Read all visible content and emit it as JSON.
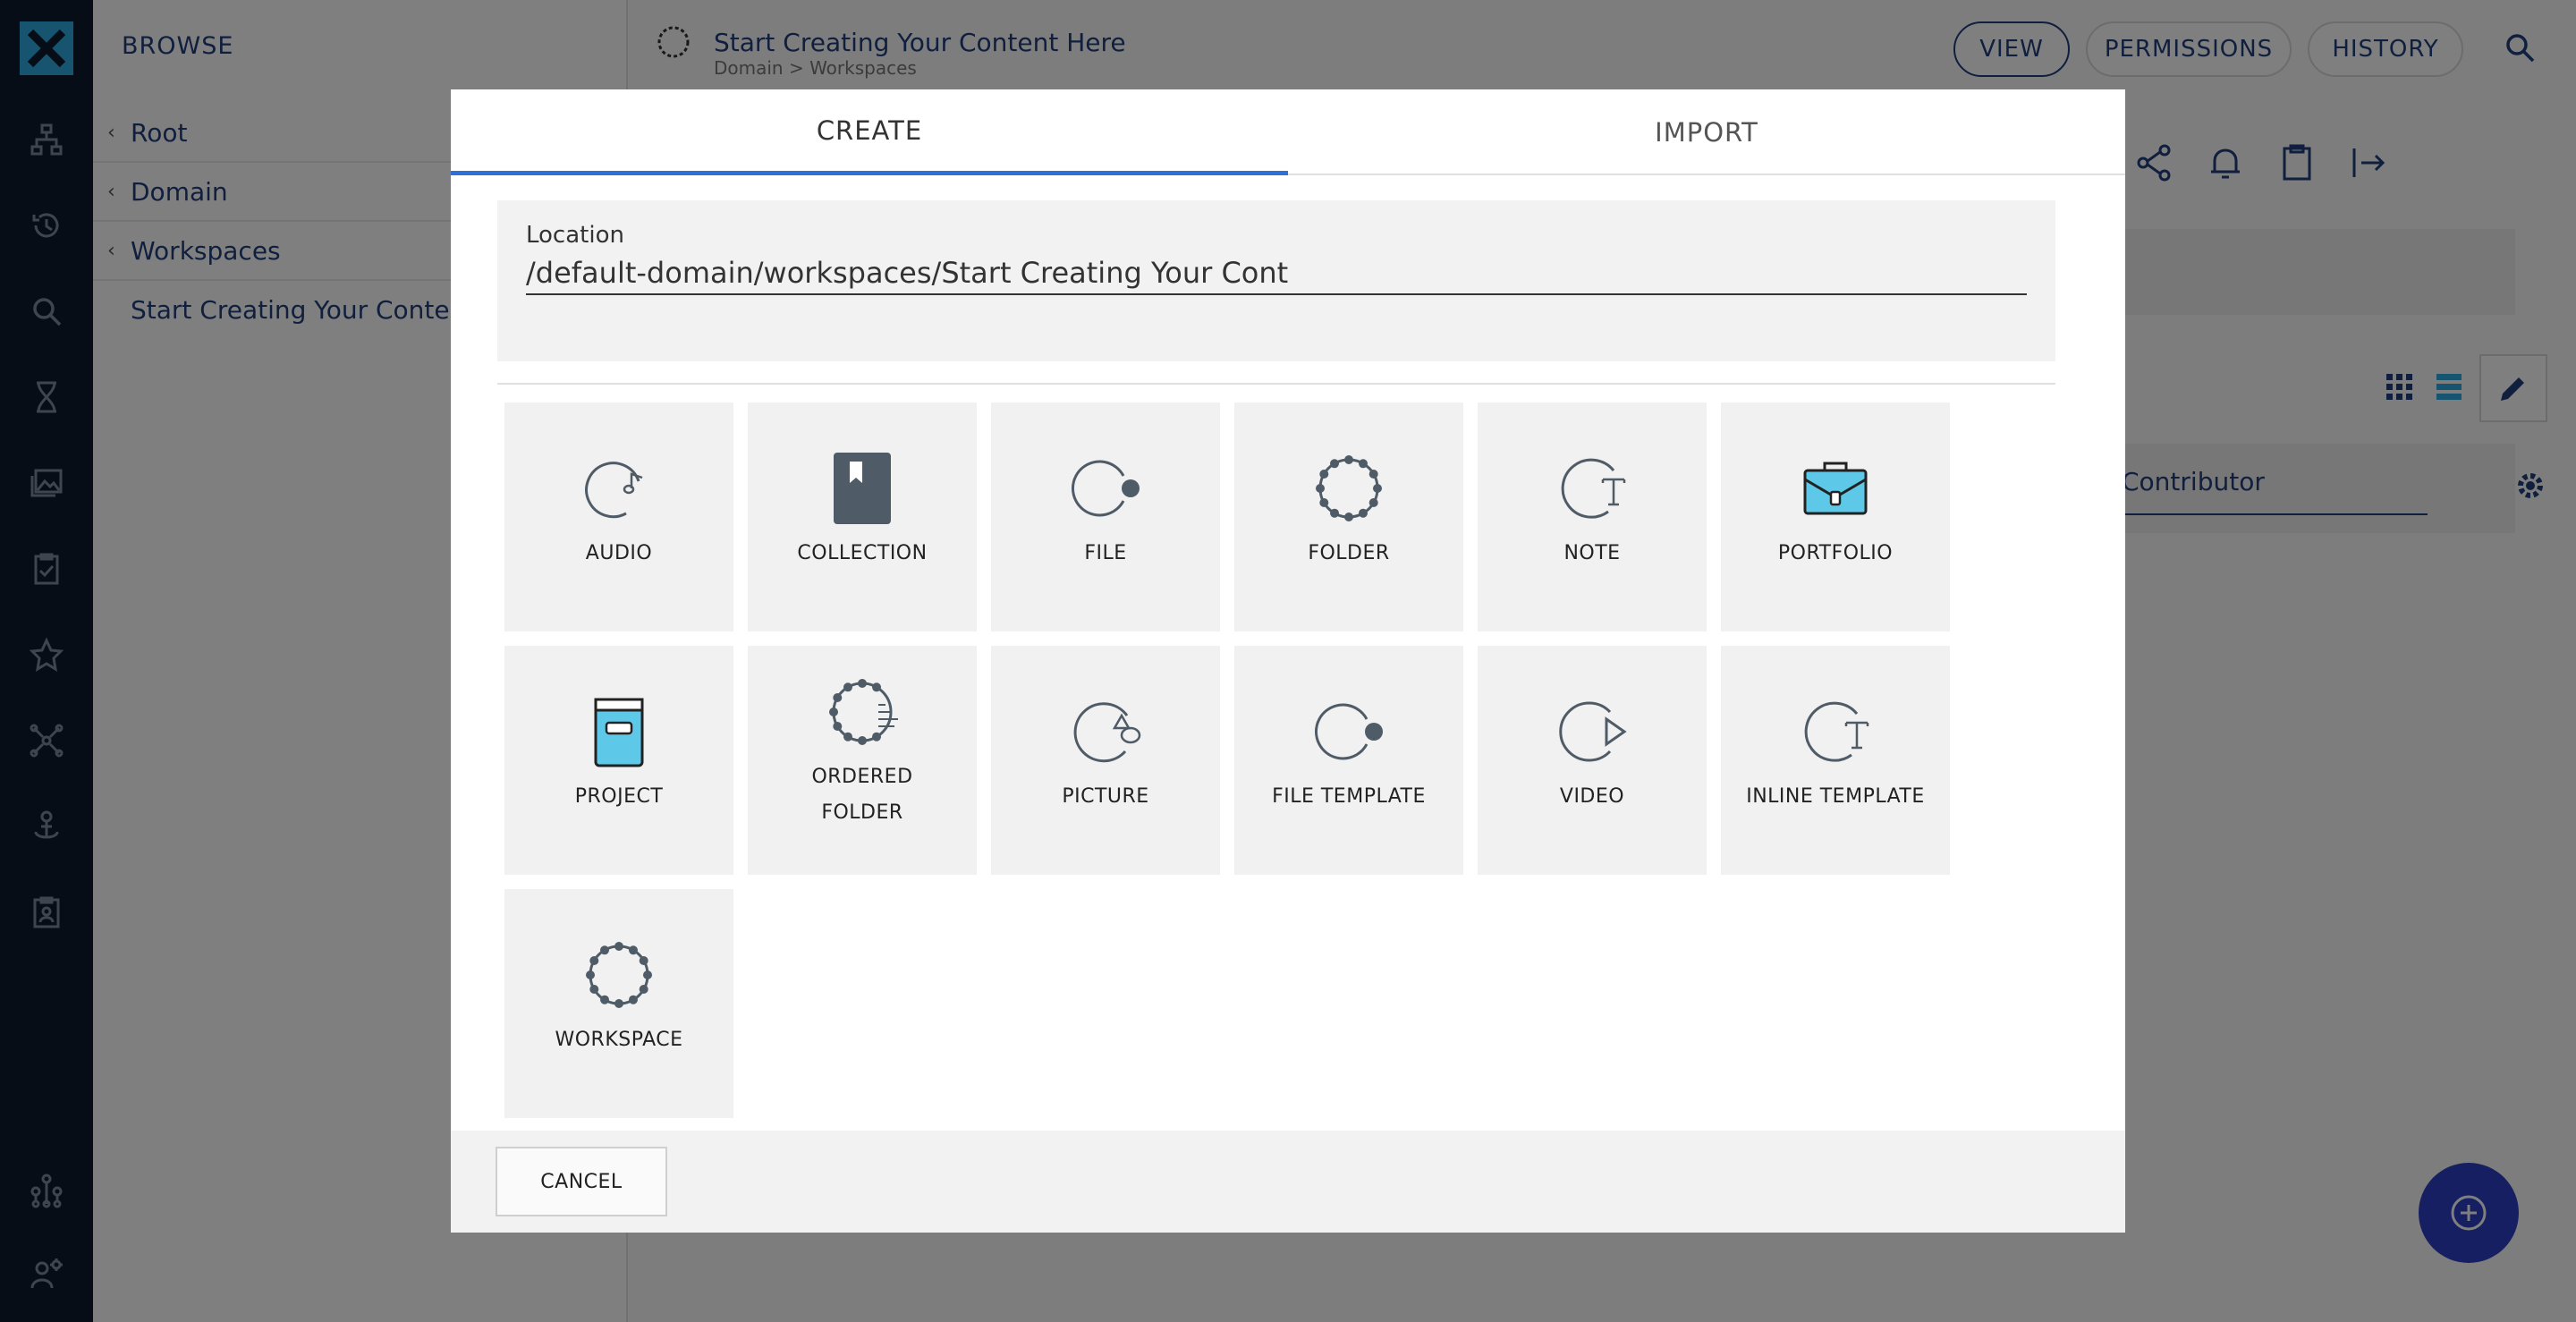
{
  "browse": {
    "heading": "BROWSE",
    "breadcrumbs": [
      "Root",
      "Domain",
      "Workspaces"
    ],
    "current": "Start Creating Your Content Here"
  },
  "header": {
    "title": "Start Creating Your Content Here",
    "path": "Domain > Workspaces",
    "buttons": {
      "view": "VIEW",
      "permissions": "PERMISSIONS",
      "history": "HISTORY"
    }
  },
  "main": {
    "contributor_filter": "Contributor"
  },
  "dialog": {
    "tabs": {
      "create": "CREATE",
      "import": "IMPORT"
    },
    "location": {
      "label": "Location",
      "value": "/default-domain/workspaces/Start Creating Your Cont"
    },
    "doc_types": [
      {
        "label": "AUDIO",
        "icon": "audio-icon"
      },
      {
        "label": "COLLECTION",
        "icon": "collection-icon"
      },
      {
        "label": "FILE",
        "icon": "file-icon"
      },
      {
        "label": "FOLDER",
        "icon": "folder-icon"
      },
      {
        "label": "NOTE",
        "icon": "note-icon"
      },
      {
        "label": "PORTFOLIO",
        "icon": "portfolio-icon"
      },
      {
        "label": "PROJECT",
        "icon": "project-icon"
      },
      {
        "label_line1": "ORDERED",
        "label_line2": "FOLDER",
        "icon": "ordered-folder-icon"
      },
      {
        "label": "PICTURE",
        "icon": "picture-icon"
      },
      {
        "label": "FILE TEMPLATE",
        "icon": "file-template-icon"
      },
      {
        "label": "VIDEO",
        "icon": "video-icon"
      },
      {
        "label": "INLINE TEMPLATE",
        "icon": "inline-template-icon"
      },
      {
        "label": "WORKSPACE",
        "icon": "workspace-icon"
      }
    ],
    "cancel_label": "CANCEL"
  },
  "colors": {
    "rail": "#0f1a2e",
    "accent": "#2e6fd8",
    "brand": "#213f7d",
    "tile_bg": "#f1f1f1",
    "icon": "#4f5b66",
    "portfolio_fill": "#5dc8e8"
  }
}
